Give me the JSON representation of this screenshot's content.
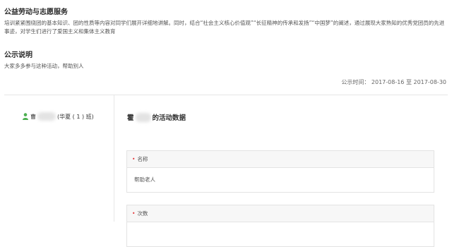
{
  "activity": {
    "title": "公益劳动与志愿服务",
    "description": "培训紧紧围绕团的基本知识、团的性质等内容对同学们展开详细地讲解。同时，结合“社会主义核心价值观”“长征精神的传承和发扬”“中国梦”的阐述，通过展现大家熟知的优秀党团员的先进事迹，对学生们进行了爱国主义和集体主义教育"
  },
  "notice": {
    "title": "公示说明",
    "text": "大家多多参与这种活动，帮助别人",
    "time_label": "公示时间：",
    "time_start": "2017-08-16",
    "time_sep": "至",
    "time_end": "2017-08-30"
  },
  "student": {
    "name_prefix": "曹",
    "class": "(华夏 ( 1 ) 班)",
    "icon": "person-icon",
    "icon_color": "#4caf50"
  },
  "detail": {
    "title_prefix": "霍",
    "title_suffix": "的活动数据",
    "fields": [
      {
        "label": "名称",
        "value": "帮助老人"
      },
      {
        "label": "次数",
        "value": ""
      }
    ]
  }
}
